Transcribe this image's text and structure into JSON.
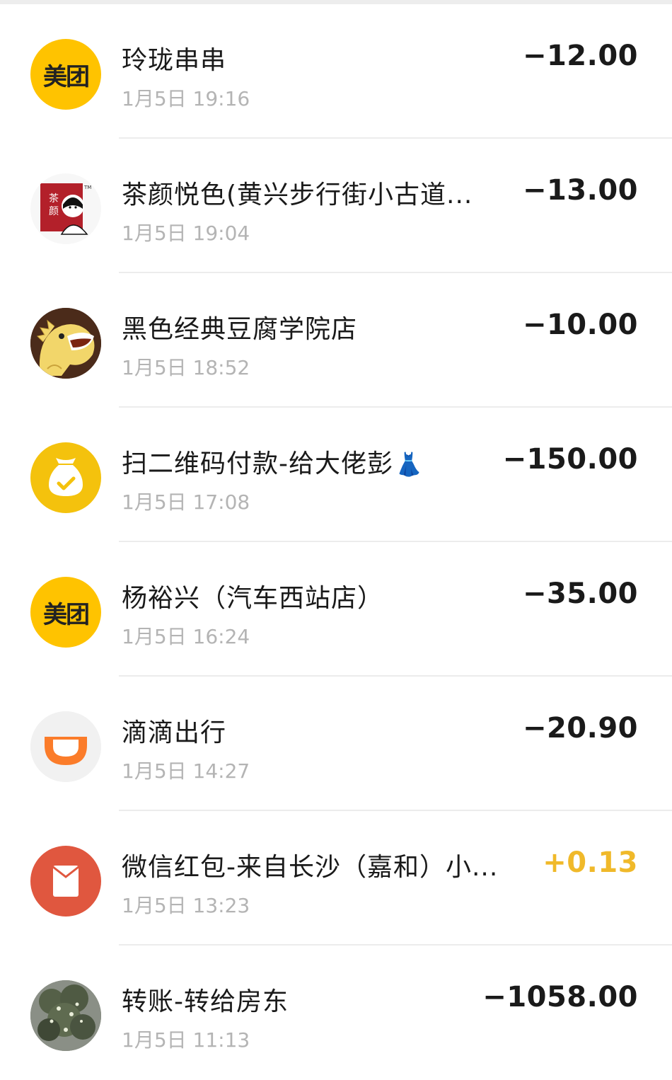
{
  "colors": {
    "meituan_yellow": "#ffc300",
    "wallet_yellow": "#f4c20d",
    "didi_orange": "#fb7c2a",
    "redpacket_red": "#e0573f",
    "income_gold": "#f0b92a"
  },
  "transactions": [
    {
      "icon": "meituan-logo-icon",
      "icon_text": "美团",
      "title": "玲珑串串",
      "time": "1月5日 19:16",
      "amount": "−12.00",
      "type": "expense"
    },
    {
      "icon": "chayanyuese-logo-icon",
      "title": "茶颜悦色(黄兴步行街小古道...",
      "time": "1月5日 19:04",
      "amount": "−13.00",
      "type": "expense"
    },
    {
      "icon": "dinosaur-logo-icon",
      "title": "黑色经典豆腐学院店",
      "time": "1月5日 18:52",
      "amount": "−10.00",
      "type": "expense"
    },
    {
      "icon": "money-bag-check-icon",
      "title": "扫二维码付款-给大佬彭",
      "title_emoji": "👗",
      "time": "1月5日 17:08",
      "amount": "−150.00",
      "type": "expense"
    },
    {
      "icon": "meituan-logo-icon",
      "icon_text": "美团",
      "title": "杨裕兴（汽车西站店）",
      "time": "1月5日 16:24",
      "amount": "−35.00",
      "type": "expense"
    },
    {
      "icon": "didi-logo-icon",
      "title": "滴滴出行",
      "time": "1月5日 14:27",
      "amount": "−20.90",
      "type": "expense"
    },
    {
      "icon": "red-packet-icon",
      "title": "微信红包-来自长沙（嘉和）小...",
      "time": "1月5日 13:23",
      "amount": "+0.13",
      "type": "income"
    },
    {
      "icon": "tree-photo-avatar-icon",
      "title": "转账-转给房东",
      "time": "1月5日 11:13",
      "amount": "−1058.00",
      "type": "expense"
    }
  ]
}
